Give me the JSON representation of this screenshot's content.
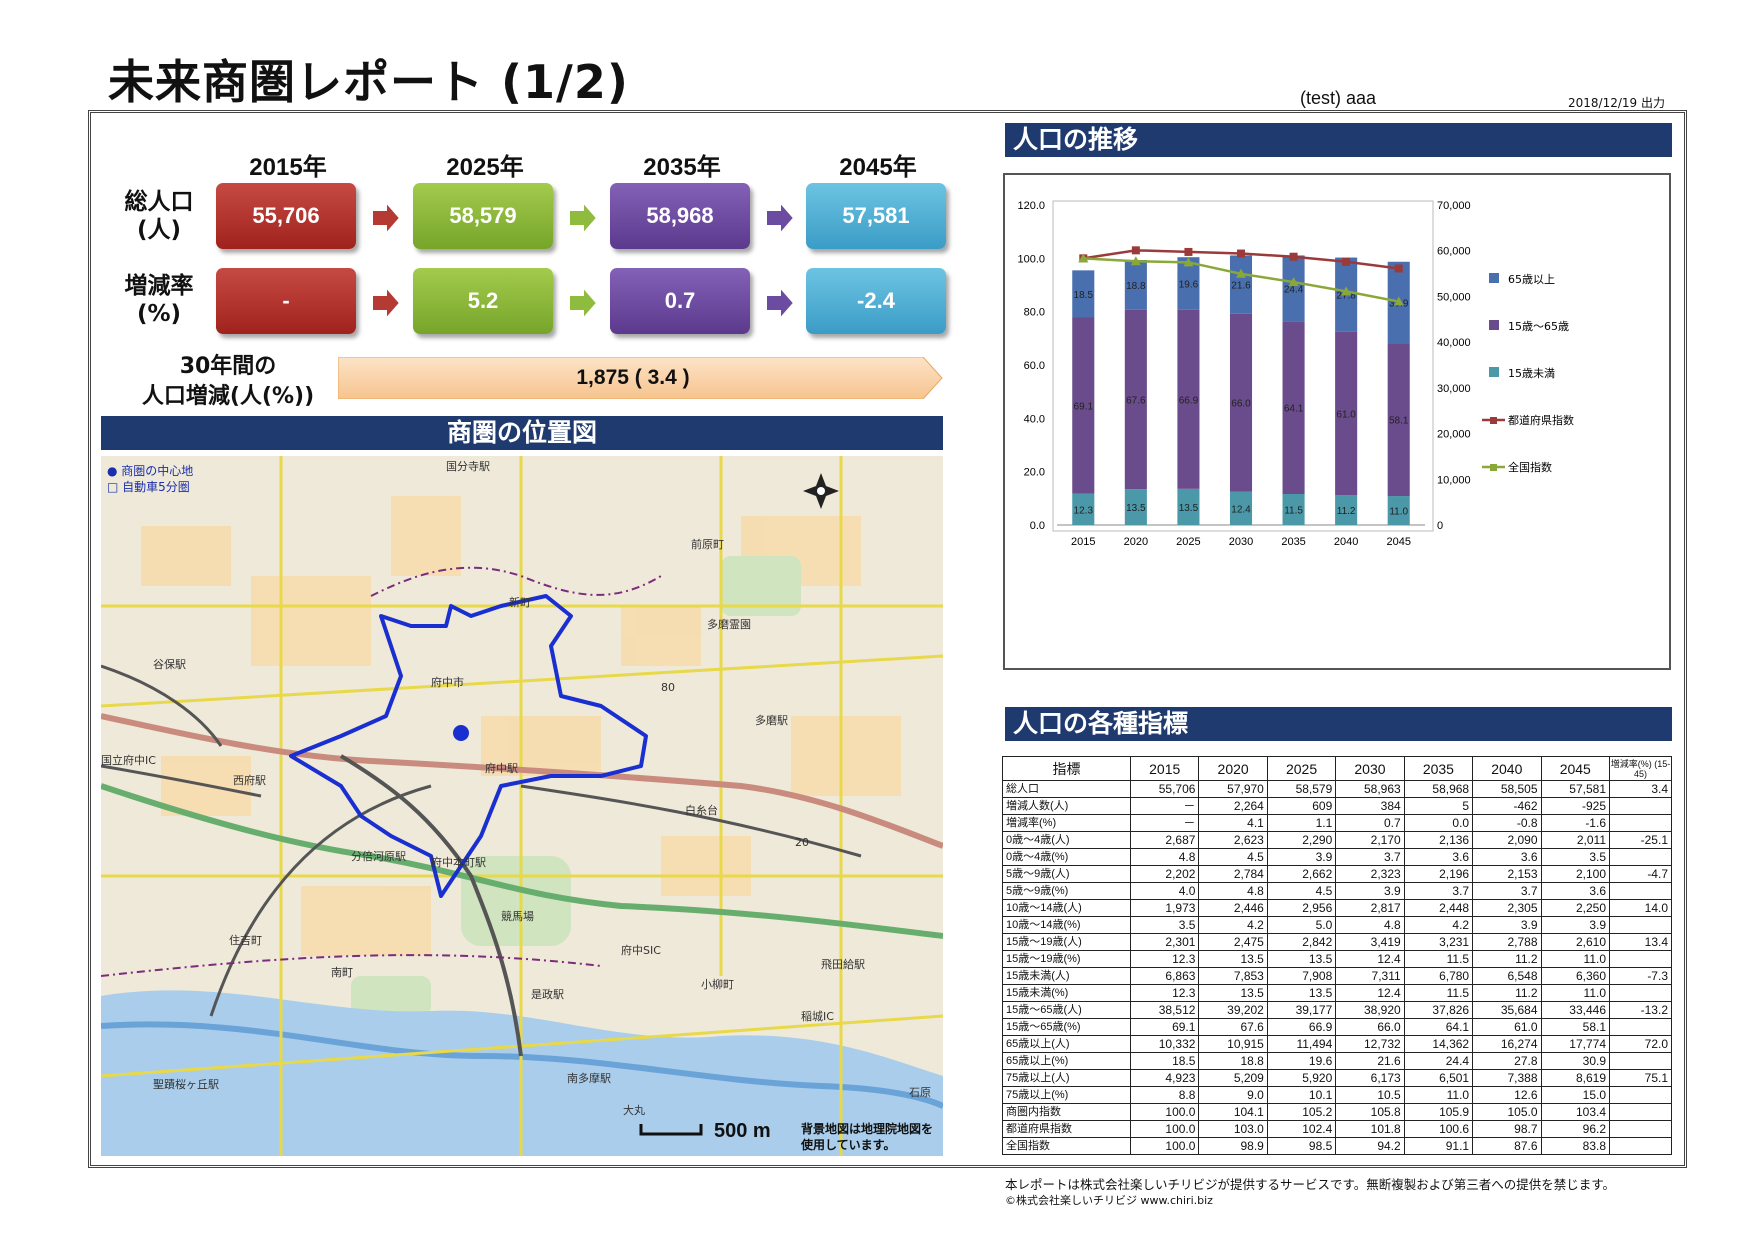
{
  "header": {
    "title": "未来商圏レポート (1/2)",
    "client": "(test) aaa",
    "issued": "2018/12/19 出力"
  },
  "summary": {
    "years": [
      "2015年",
      "2025年",
      "2035年",
      "2045年"
    ],
    "population_label_1": "総人口",
    "population_label_2": "(人)",
    "population": [
      "55,706",
      "58,579",
      "58,968",
      "57,581"
    ],
    "rate_label_1": "増減率",
    "rate_label_2": "(%)",
    "rates": [
      "-",
      "5.2",
      "0.7",
      "-2.4"
    ],
    "span_label_1": "30年間の",
    "span_label_2": "人口増減(人(%))",
    "span_value": "1,875 ( 3.4 )"
  },
  "map": {
    "title": "商圏の位置図",
    "legend": [
      "● 商圏の中心地",
      "□ 自動車5分圏"
    ],
    "labels": [
      "国分寺駅",
      "前原町",
      "新町",
      "多磨霊園",
      "谷保駅",
      "府中市",
      "多磨駅",
      "国立府中IC",
      "西府駅",
      "府中駅",
      "白糸台",
      "分倍河原駅",
      "府中本町駅",
      "競馬場",
      "住吉町",
      "南町",
      "府中SIC",
      "是政駅",
      "飛田給駅",
      "小柳町",
      "稲城IC",
      "聖蹟桜ヶ丘駅",
      "南多摩駅",
      "大丸",
      "石原",
      "80",
      "20"
    ],
    "scale": "500 m",
    "note": "背景地図は地理院地図を使用しています。"
  },
  "population_chart": {
    "title": "人口の推移",
    "chart_data": {
      "type": "bar",
      "categories": [
        "2015",
        "2020",
        "2025",
        "2030",
        "2035",
        "2040",
        "2045"
      ],
      "series": [
        {
          "name": "15歳未満",
          "values": [
            12.3,
            13.5,
            13.5,
            12.4,
            11.5,
            11.2,
            11.0
          ],
          "color": "#4a98a8"
        },
        {
          "name": "15歳～65歳",
          "values": [
            69.1,
            67.6,
            66.9,
            66.0,
            64.1,
            61.0,
            58.1
          ],
          "color": "#6a4c8c"
        },
        {
          "name": "65歳以上",
          "values": [
            18.5,
            18.8,
            19.6,
            21.6,
            24.4,
            27.8,
            30.9
          ],
          "color": "#4a6fae"
        },
        {
          "name": "都道府県指数",
          "values": [
            100.0,
            103.0,
            102.4,
            101.8,
            100.6,
            98.7,
            96.2
          ],
          "color": "#9b3a3a"
        },
        {
          "name": "全国指数",
          "values": [
            100.0,
            98.9,
            98.5,
            94.2,
            91.1,
            87.6,
            83.8
          ],
          "color": "#8aa838"
        }
      ],
      "bar_totals": [
        55706,
        57970,
        58579,
        58963,
        58968,
        58505,
        57581
      ],
      "y_left_ticks": [
        "0.0",
        "20.0",
        "40.0",
        "60.0",
        "80.0",
        "100.0",
        "120.0"
      ],
      "y_right_ticks": [
        "0",
        "10,000",
        "20,000",
        "30,000",
        "40,000",
        "50,000",
        "60,000",
        "70,000"
      ],
      "ylim_left": [
        0,
        120
      ],
      "ylim_right": [
        0,
        70000
      ],
      "legend_order": [
        "65歳以上",
        "15歳～65歳",
        "15歳未満",
        "都道府県指数",
        "全国指数"
      ],
      "legend_position": "right"
    }
  },
  "indicators": {
    "title": "人口の各種指標",
    "columns": [
      "指標",
      "2015",
      "2020",
      "2025",
      "2030",
      "2035",
      "2040",
      "2045",
      "増減率(%) (15-45)"
    ],
    "rows": [
      [
        "総人口",
        "55,706",
        "57,970",
        "58,579",
        "58,963",
        "58,968",
        "58,505",
        "57,581",
        "3.4"
      ],
      [
        "増減人数(人)",
        "－",
        "2,264",
        "609",
        "384",
        "5",
        "-462",
        "-925",
        ""
      ],
      [
        "増減率(%)",
        "－",
        "4.1",
        "1.1",
        "0.7",
        "0.0",
        "-0.8",
        "-1.6",
        ""
      ],
      [
        "0歳～4歳(人)",
        "2,687",
        "2,623",
        "2,290",
        "2,170",
        "2,136",
        "2,090",
        "2,011",
        "-25.1"
      ],
      [
        "0歳～4歳(%)",
        "4.8",
        "4.5",
        "3.9",
        "3.7",
        "3.6",
        "3.6",
        "3.5",
        ""
      ],
      [
        "5歳～9歳(人)",
        "2,202",
        "2,784",
        "2,662",
        "2,323",
        "2,196",
        "2,153",
        "2,100",
        "-4.7"
      ],
      [
        "5歳～9歳(%)",
        "4.0",
        "4.8",
        "4.5",
        "3.9",
        "3.7",
        "3.7",
        "3.6",
        ""
      ],
      [
        "10歳～14歳(人)",
        "1,973",
        "2,446",
        "2,956",
        "2,817",
        "2,448",
        "2,305",
        "2,250",
        "14.0"
      ],
      [
        "10歳～14歳(%)",
        "3.5",
        "4.2",
        "5.0",
        "4.8",
        "4.2",
        "3.9",
        "3.9",
        ""
      ],
      [
        "15歳～19歳(人)",
        "2,301",
        "2,475",
        "2,842",
        "3,419",
        "3,231",
        "2,788",
        "2,610",
        "13.4"
      ],
      [
        "15歳～19歳(%)",
        "12.3",
        "13.5",
        "13.5",
        "12.4",
        "11.5",
        "11.2",
        "11.0",
        ""
      ],
      [
        "15歳未満(人)",
        "6,863",
        "7,853",
        "7,908",
        "7,311",
        "6,780",
        "6,548",
        "6,360",
        "-7.3"
      ],
      [
        "15歳未満(%)",
        "12.3",
        "13.5",
        "13.5",
        "12.4",
        "11.5",
        "11.2",
        "11.0",
        ""
      ],
      [
        "15歳～65歳(人)",
        "38,512",
        "39,202",
        "39,177",
        "38,920",
        "37,826",
        "35,684",
        "33,446",
        "-13.2"
      ],
      [
        "15歳～65歳(%)",
        "69.1",
        "67.6",
        "66.9",
        "66.0",
        "64.1",
        "61.0",
        "58.1",
        ""
      ],
      [
        "65歳以上(人)",
        "10,332",
        "10,915",
        "11,494",
        "12,732",
        "14,362",
        "16,274",
        "17,774",
        "72.0"
      ],
      [
        "65歳以上(%)",
        "18.5",
        "18.8",
        "19.6",
        "21.6",
        "24.4",
        "27.8",
        "30.9",
        ""
      ],
      [
        "75歳以上(人)",
        "4,923",
        "5,209",
        "5,920",
        "6,173",
        "6,501",
        "7,388",
        "8,619",
        "75.1"
      ],
      [
        "75歳以上(%)",
        "8.8",
        "9.0",
        "10.1",
        "10.5",
        "11.0",
        "12.6",
        "15.0",
        ""
      ],
      [
        "商圏内指数",
        "100.0",
        "104.1",
        "105.2",
        "105.8",
        "105.9",
        "105.0",
        "103.4",
        ""
      ],
      [
        "都道府県指数",
        "100.0",
        "103.0",
        "102.4",
        "101.8",
        "100.6",
        "98.7",
        "96.2",
        ""
      ],
      [
        "全国指数",
        "100.0",
        "98.9",
        "98.5",
        "94.2",
        "91.1",
        "87.6",
        "83.8",
        ""
      ]
    ]
  },
  "footer": {
    "notice": "本レポートは株式会社楽しいチリビジが提供するサービスです。無断複製および第三者への提供を禁じます。",
    "copyright": "©株式会社楽しいチリビジ www.chiri.biz"
  }
}
